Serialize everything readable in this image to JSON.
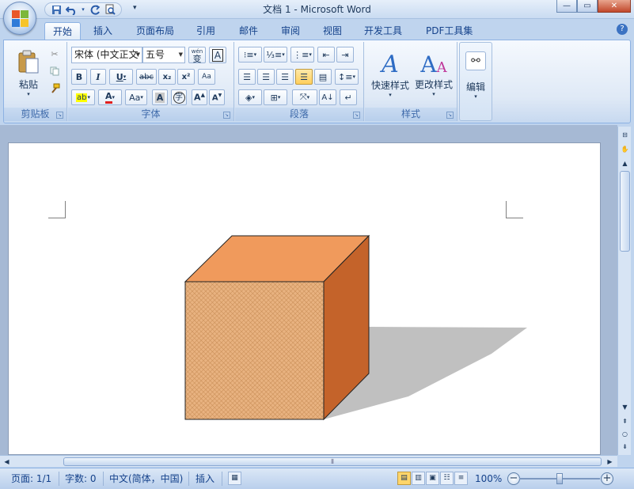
{
  "window": {
    "title": "文档 1 - Microsoft Word"
  },
  "qat": {
    "save": "save-icon",
    "undo": "undo-icon",
    "redo": "redo-icon",
    "print_preview": "print-preview-icon"
  },
  "tabs": [
    {
      "label": "开始",
      "active": true
    },
    {
      "label": "插入"
    },
    {
      "label": "页面布局"
    },
    {
      "label": "引用"
    },
    {
      "label": "邮件"
    },
    {
      "label": "审阅"
    },
    {
      "label": "视图"
    },
    {
      "label": "开发工具"
    },
    {
      "label": "PDF工具集"
    }
  ],
  "groups": {
    "clipboard": {
      "label": "剪贴板",
      "paste": "粘贴"
    },
    "font": {
      "label": "字体",
      "font_name": "宋体 (中文正文",
      "font_size": "五号",
      "phonetic": "wén",
      "phonetic_char": "变"
    },
    "paragraph": {
      "label": "段落"
    },
    "styles": {
      "label": "样式",
      "quick_styles": "快速样式",
      "change_styles": "更改样式"
    },
    "editing": {
      "label": "编辑"
    }
  },
  "status": {
    "page": "页面: 1/1",
    "words": "字数: 0",
    "language": "中文(简体，中国)",
    "mode": "插入",
    "zoom": "100%"
  },
  "colors": {
    "cube_top": "#f09a5c",
    "cube_front": "#e8b280",
    "cube_side": "#c4632a",
    "shadow": "#c0c0c0"
  }
}
